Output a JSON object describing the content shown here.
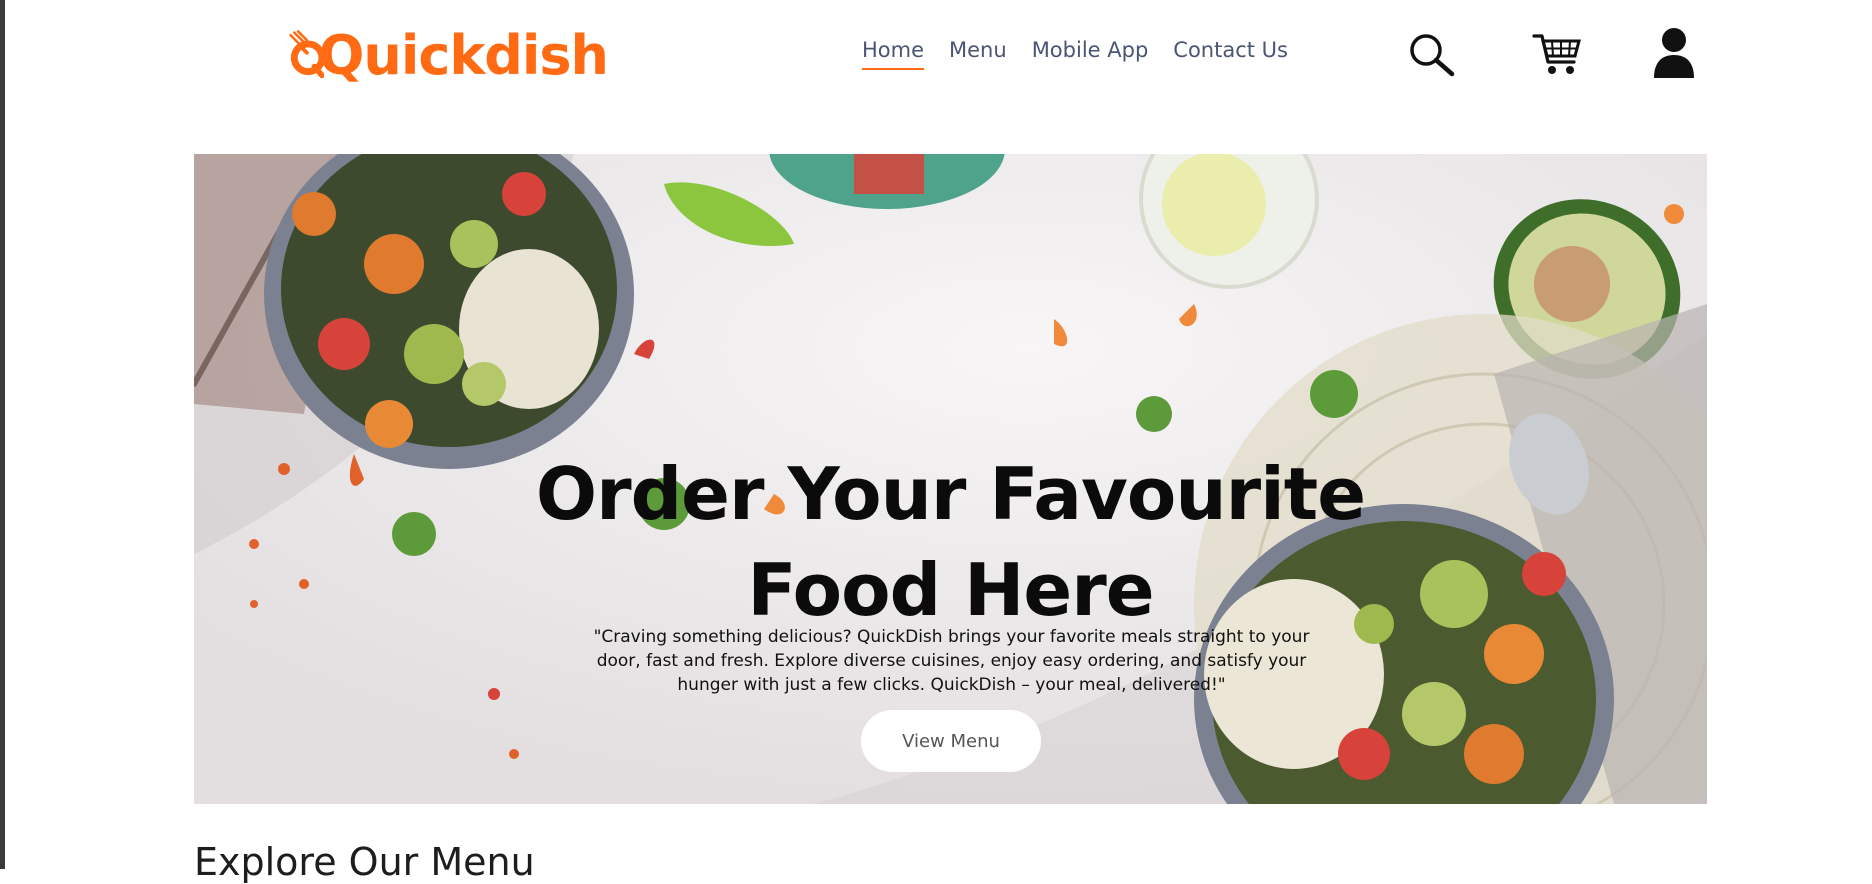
{
  "header": {
    "logo_text": "Quickdish",
    "nav": [
      {
        "label": "Home",
        "active": true
      },
      {
        "label": "Menu",
        "active": false
      },
      {
        "label": "Mobile App",
        "active": false
      },
      {
        "label": "Contact Us",
        "active": false
      }
    ],
    "icons": [
      "search-icon",
      "cart-icon",
      "user-icon"
    ]
  },
  "hero": {
    "title_line1": "Order Your Favourite",
    "title_line2": "Food Here",
    "description": "\"Craving something delicious? QuickDish brings your favorite meals straight to your door, fast and fresh. Explore diverse cuisines, enjoy easy ordering, and satisfy your hunger with just a few clicks. QuickDish – your meal, delivered!\"",
    "button_label": "View Menu"
  },
  "section": {
    "title": "Explore Our Menu"
  },
  "colors": {
    "brand": "#ff6a13",
    "nav_text": "#4a5573",
    "hero_bg": "#ece8ea"
  }
}
